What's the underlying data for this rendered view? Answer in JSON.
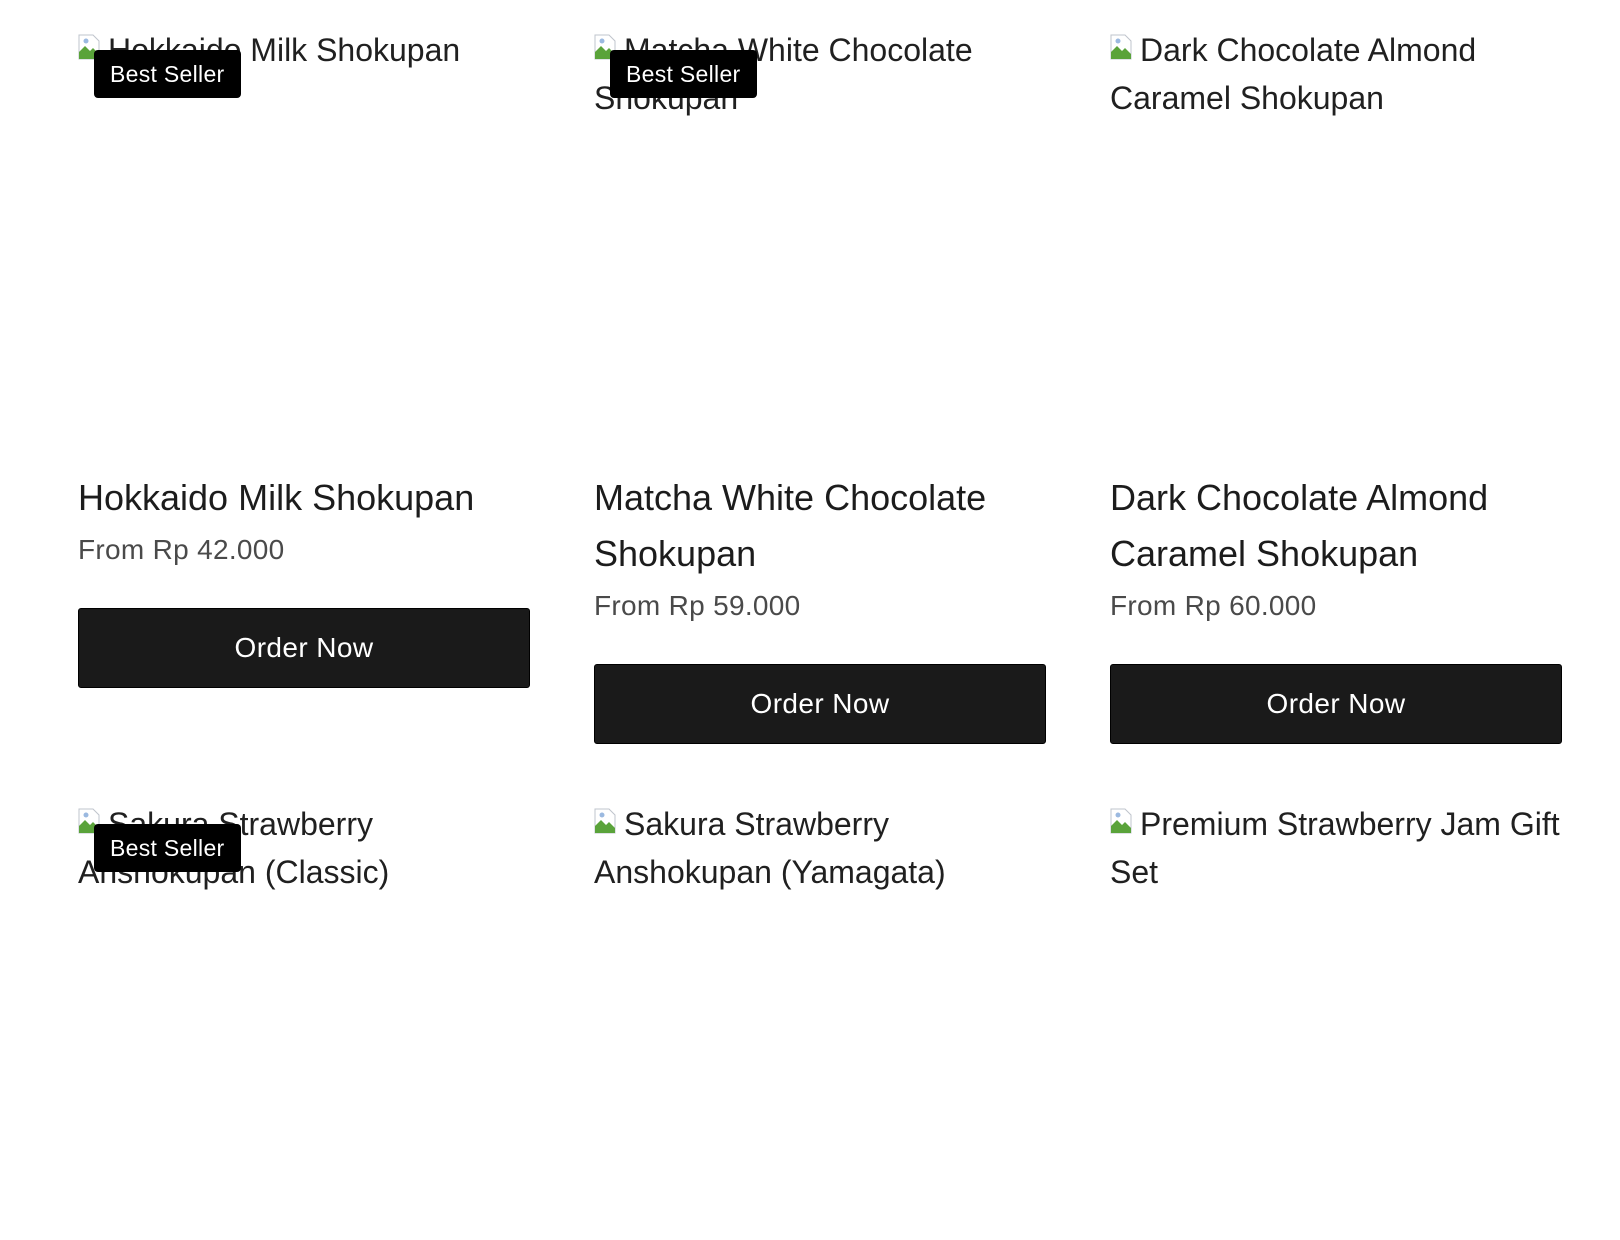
{
  "products": [
    {
      "image_alt": "Hokkaido Milk Shokupan",
      "badge": "Best Seller",
      "title": "Hokkaido Milk Shokupan",
      "price": "From Rp 42.000",
      "button_label": "Order Now"
    },
    {
      "image_alt": "Matcha White Chocolate Shokupan",
      "badge": "Best Seller",
      "title": "Matcha White Chocolate Shokupan",
      "price": "From Rp 59.000",
      "button_label": "Order Now"
    },
    {
      "image_alt": "Dark Chocolate Almond Caramel Shokupan",
      "badge": "",
      "title": "Dark Chocolate Almond Caramel Shokupan",
      "price": "From Rp 60.000",
      "button_label": "Order Now"
    },
    {
      "image_alt": "Sakura Strawberry Anshokupan (Classic)",
      "badge": "Best Seller",
      "title": "",
      "price": "",
      "button_label": ""
    },
    {
      "image_alt": "Sakura Strawberry Anshokupan (Yamagata)",
      "badge": "",
      "title": "",
      "price": "",
      "button_label": ""
    },
    {
      "image_alt": "Premium Strawberry Jam Gift Set",
      "badge": "",
      "title": "",
      "price": "",
      "button_label": ""
    }
  ],
  "colors": {
    "button_bg": "#1a1a1a",
    "badge_bg": "#000000",
    "price_text": "#4a4a4a"
  }
}
